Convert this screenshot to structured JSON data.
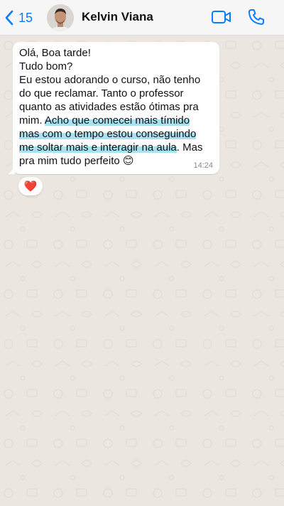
{
  "header": {
    "back_count": "15",
    "contact_name": "Kelvin Viana"
  },
  "icons": {
    "back": "chevron-left-icon",
    "video": "video-camera-icon",
    "call": "phone-icon",
    "reaction": "red-heart-icon"
  },
  "colors": {
    "accent": "#0a7cff",
    "chat_background": "#ebe6df",
    "bubble": "#ffffff",
    "highlight": "#a7e2f2"
  },
  "message": {
    "lines": [
      "Olá, Boa tarde!",
      "Tudo bom?",
      "Eu estou adorando o curso, não tenho",
      "do que reclamar. Tanto o professor",
      "quanto as atividades estão ótimas pra"
    ],
    "line6_plain": "mim. ",
    "line6_highlight": "Acho que comecei mais tímido",
    "line7_highlight": "mas com o tempo estou conseguindo",
    "line8_highlight": "me soltar mais e interagir na aula",
    "line8_plain": ". Mas",
    "line9": "pra mim tudo perfeito 😊",
    "time": "14:24"
  },
  "reaction": {
    "emoji": "❤️"
  }
}
